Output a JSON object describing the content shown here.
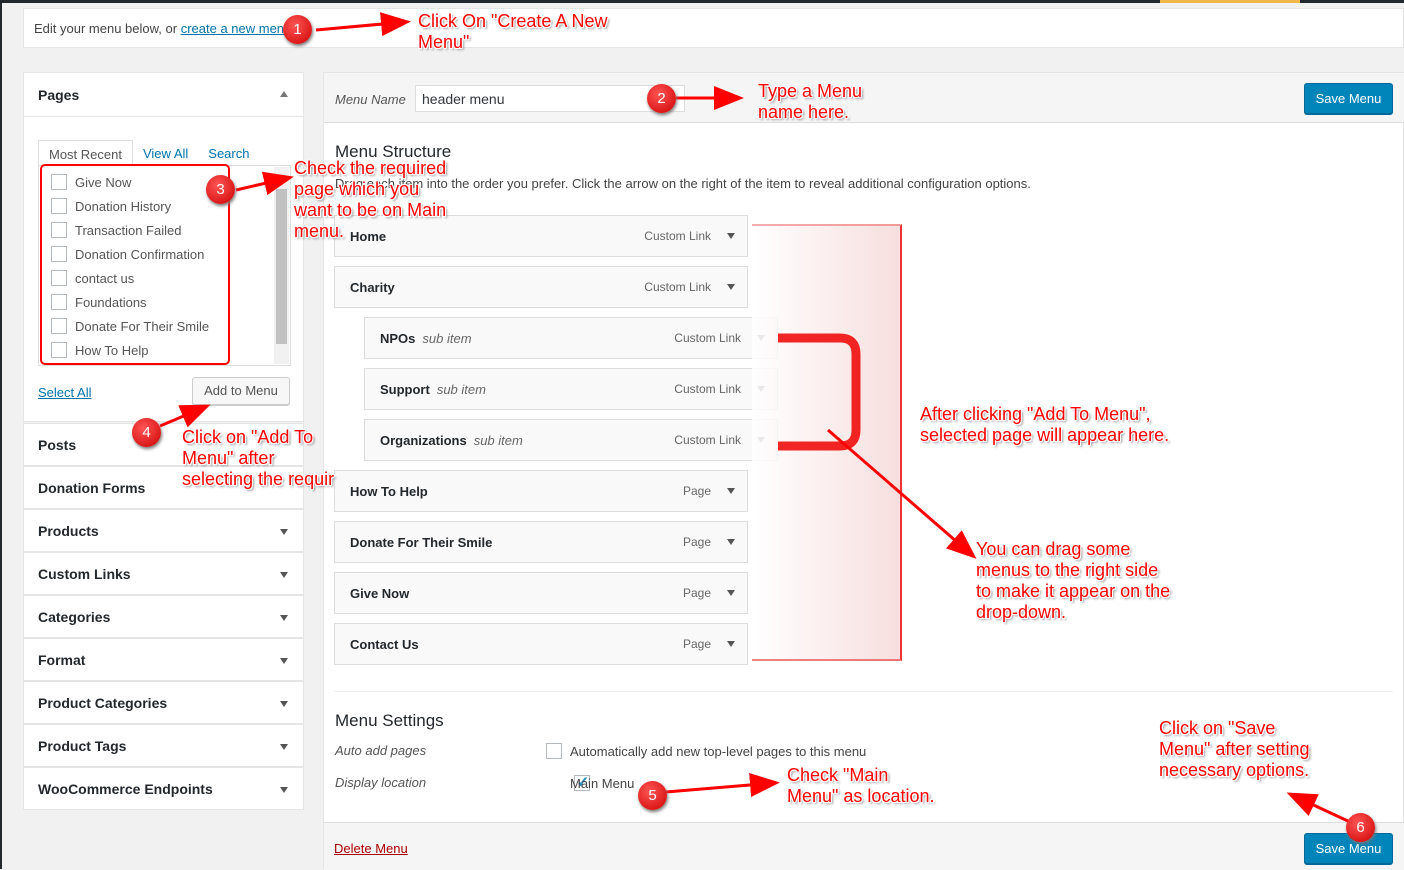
{
  "notice": {
    "text": "Edit your menu below, or ",
    "link": "create a new menu",
    "suffix": "."
  },
  "left": {
    "pages_title": "Pages",
    "tabs": [
      "Most Recent",
      "View All",
      "Search"
    ],
    "pages": [
      "Give Now",
      "Donation History",
      "Transaction Failed",
      "Donation Confirmation",
      "contact us",
      "Foundations",
      "Donate For Their Smile",
      "How To Help"
    ],
    "select_all": "Select All",
    "add_to_menu": "Add to Menu",
    "sections": [
      "Posts",
      "Donation Forms",
      "Products",
      "Custom Links",
      "Categories",
      "Format",
      "Product Categories",
      "Product Tags",
      "WooCommerce Endpoints"
    ]
  },
  "main": {
    "menu_name_label": "Menu Name",
    "menu_name_value": "header menu",
    "save_label": "Save Menu",
    "structure_title": "Menu Structure",
    "structure_desc": "Drag each item into the order you prefer. Click the arrow on the right of the item to reveal additional configuration options.",
    "items": [
      {
        "title": "Home",
        "sub": "",
        "type": "Custom Link",
        "depth": 0
      },
      {
        "title": "Charity",
        "sub": "",
        "type": "Custom Link",
        "depth": 0
      },
      {
        "title": "NPOs",
        "sub": "sub item",
        "type": "Custom Link",
        "depth": 1
      },
      {
        "title": "Support",
        "sub": "sub item",
        "type": "Custom Link",
        "depth": 1
      },
      {
        "title": "Organizations",
        "sub": "sub item",
        "type": "Custom Link",
        "depth": 1
      },
      {
        "title": "How To Help",
        "sub": "",
        "type": "Page",
        "depth": 0
      },
      {
        "title": "Donate For Their Smile",
        "sub": "",
        "type": "Page",
        "depth": 0
      },
      {
        "title": "Give Now",
        "sub": "",
        "type": "Page",
        "depth": 0
      },
      {
        "title": "Contact Us",
        "sub": "",
        "type": "Page",
        "depth": 0
      }
    ],
    "settings_title": "Menu Settings",
    "auto_add_label": "Auto add pages",
    "auto_add_text": "Automatically add new top-level pages to this menu",
    "auto_add_checked": false,
    "location_label": "Display location",
    "location_text": "Main Menu",
    "location_checked": true,
    "delete_label": "Delete Menu"
  },
  "annotations": [
    {
      "n": "1",
      "text": "Click On \"Create A New\nMenu\""
    },
    {
      "n": "2",
      "text": "Type a Menu\nname here."
    },
    {
      "n": "3",
      "text": "Check the required\npage which you\nwant to be on Main\nmenu."
    },
    {
      "n": "4",
      "text": "Click on \"Add To\nMenu\" after\nselecting the requir"
    },
    {
      "n": "",
      "text": "After clicking \"Add To Menu\",\nselected page will appear here."
    },
    {
      "n": "",
      "text": "You can drag some\nmenus to the right side\nto make it appear on the\ndrop-down."
    },
    {
      "n": "5",
      "text": "Check \"Main\nMenu\" as location."
    },
    {
      "n": "6",
      "text": "Click on \"Save\nMenu\" after setting\nnecessary options."
    }
  ],
  "colors": {
    "primary": "#0085ba",
    "link": "#0073aa",
    "delete": "#a00",
    "annotation": "#ff0000"
  }
}
